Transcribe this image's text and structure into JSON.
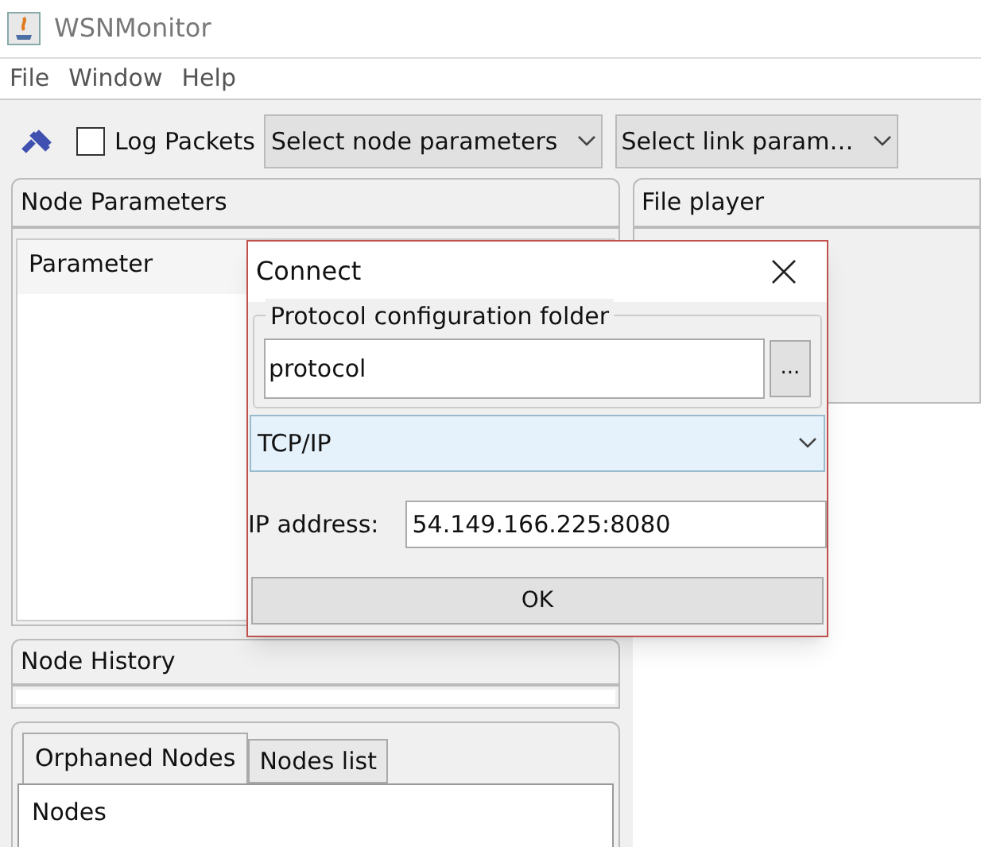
{
  "window": {
    "title": "WSNMonitor"
  },
  "menu": [
    "File",
    "Window",
    "Help"
  ],
  "toolbar": {
    "log_packets": {
      "label": "Log Packets",
      "checked": false
    },
    "node_select": "Select node parameters",
    "link_select": "Select link param…"
  },
  "node_parameters": {
    "title": "Node Parameters",
    "column": "Parameter"
  },
  "file_player": {
    "title": "File player"
  },
  "node_history": {
    "title": "Node History"
  },
  "tabs": [
    {
      "label": "Orphaned Nodes",
      "selected": true
    },
    {
      "label": "Nodes list",
      "selected": false
    }
  ],
  "nodes_list": {
    "header": "Nodes"
  },
  "dialog": {
    "title": "Connect",
    "folder_group": "Protocol configuration folder",
    "folder_value": "protocol",
    "browse": "...",
    "protocol": "TCP/IP",
    "ip_label": "IP address:",
    "ip_value": "54.149.166.225:8080",
    "ok": "OK"
  }
}
